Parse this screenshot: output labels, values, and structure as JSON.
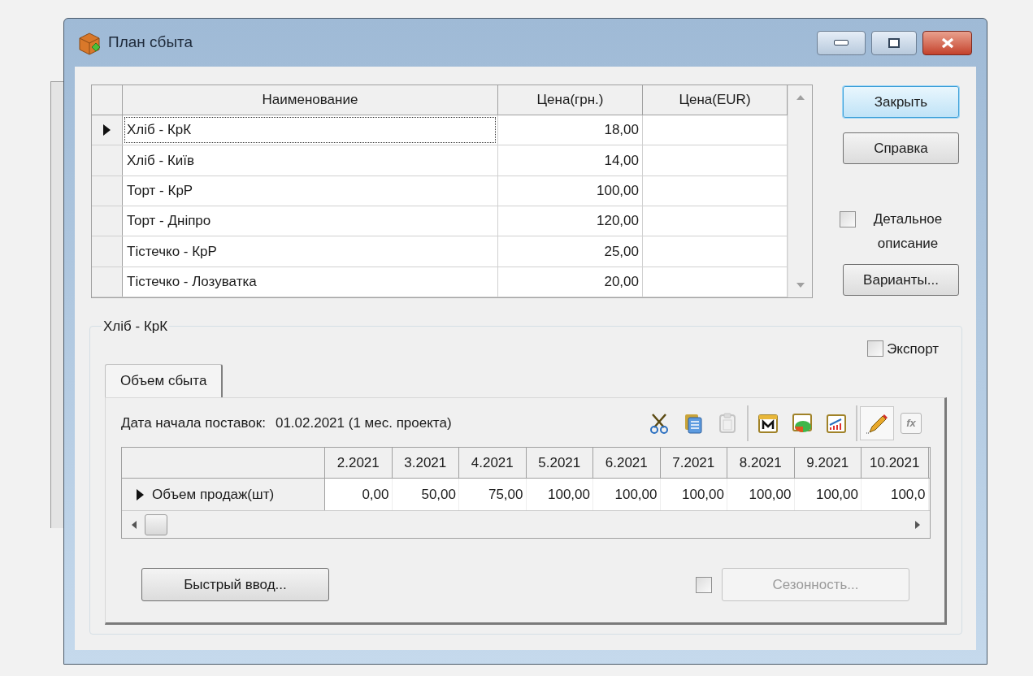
{
  "window": {
    "title": "План сбыта"
  },
  "products": {
    "columns": [
      "Наименование",
      "Цена(грн.)",
      "Цена(EUR)"
    ],
    "rows": [
      {
        "name": "Хліб - КрК",
        "price": "18,00",
        "selected": true
      },
      {
        "name": "Хліб - Київ",
        "price": "14,00",
        "selected": false
      },
      {
        "name": "Торт - КрР",
        "price": "100,00",
        "selected": false
      },
      {
        "name": "Торт - Дніпро",
        "price": "120,00",
        "selected": false
      },
      {
        "name": "Тістечко - КрР",
        "price": "25,00",
        "selected": false
      },
      {
        "name": "Тістечко - Лозуватка",
        "price": "20,00",
        "selected": false
      }
    ]
  },
  "side_buttons": [
    {
      "label": "Закрыть",
      "default": true
    },
    {
      "label": "Справка",
      "default": false
    }
  ],
  "detail_checkbox": {
    "label": "Детальное описание",
    "checked": false
  },
  "variants_button": {
    "label": "Варианты..."
  },
  "group": {
    "title": "Хліб - КрК",
    "export_checkbox": {
      "label": "Экспорт",
      "checked": false
    },
    "tabs": [
      {
        "label": "Объем сбыта",
        "selected": true
      }
    ],
    "start_date_label": "Дата начала поставок:",
    "start_date_value": "01.02.2021 (1 мес. проекта)",
    "toolbar": [
      {
        "kind": "cut",
        "disabled": false,
        "pressed": false
      },
      {
        "kind": "copy",
        "disabled": false,
        "pressed": false
      },
      {
        "kind": "paste",
        "disabled": true,
        "pressed": false
      },
      {
        "kind": "separator"
      },
      {
        "kind": "calendar",
        "disabled": false,
        "pressed": false
      },
      {
        "kind": "pie",
        "disabled": false,
        "pressed": false
      },
      {
        "kind": "bars",
        "disabled": false,
        "pressed": false
      },
      {
        "kind": "separator"
      },
      {
        "kind": "pencil",
        "disabled": false,
        "pressed": true
      },
      {
        "kind": "formula",
        "label": "fx",
        "disabled": true,
        "pressed": false
      }
    ],
    "sales_table": {
      "columns": [
        "2.2021",
        "3.2021",
        "4.2021",
        "5.2021",
        "6.2021",
        "7.2021",
        "8.2021",
        "9.2021",
        "10.2021"
      ],
      "rows": [
        {
          "label": "Объем продаж(шт)",
          "selected": true,
          "values": [
            "0,00",
            "50,00",
            "75,00",
            "100,00",
            "100,00",
            "100,00",
            "100,00",
            "100,00",
            "100,0"
          ]
        }
      ]
    },
    "quick_entry_button": {
      "label": "Быстрый ввод..."
    },
    "seasonality": {
      "checked": false,
      "button": {
        "label": "Сезонность...",
        "disabled": true
      }
    }
  }
}
